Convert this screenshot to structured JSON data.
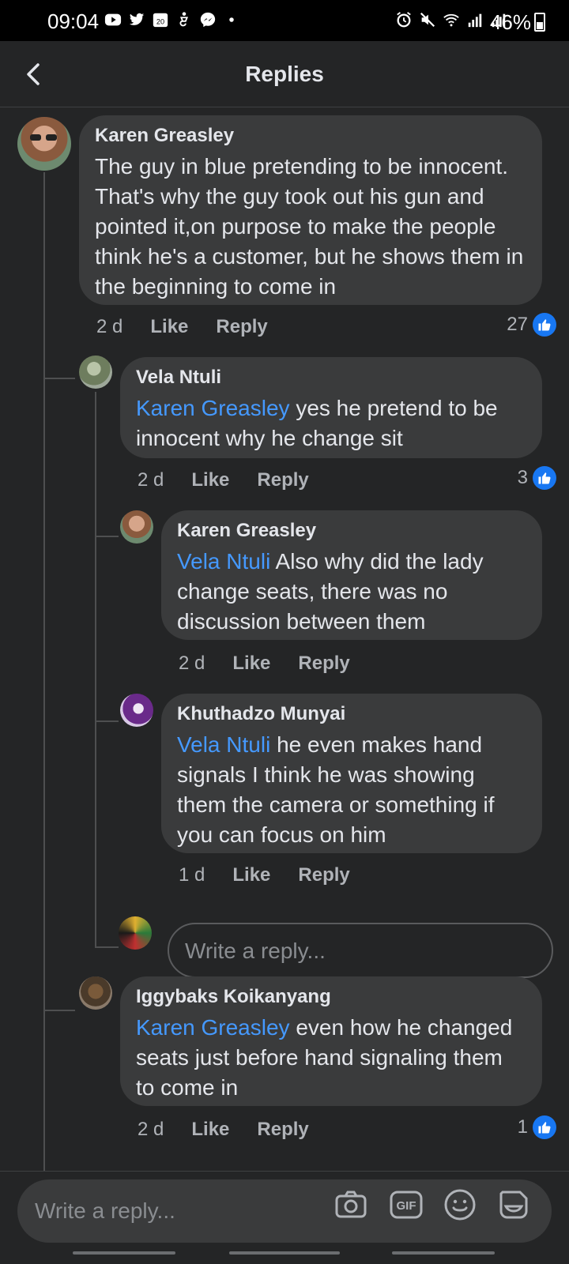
{
  "status_bar": {
    "time": "09:04",
    "left_icons": [
      "youtube-icon",
      "twitter-icon",
      "calendar-icon",
      "accessibility-icon",
      "messenger-icon",
      "dot-icon"
    ],
    "calendar_day": "20",
    "right_icons": [
      "alarm-icon",
      "mute-icon",
      "wifi-icon",
      "signal-icon",
      "signal-icon"
    ],
    "battery": "46%"
  },
  "header": {
    "title": "Replies"
  },
  "comments": [
    {
      "author": "Karen Greasley",
      "mention": "",
      "text": "The guy in blue pretending to be innocent. That's why the guy took out his gun and pointed it,on purpose to make the people think he's a customer, but he shows them in the beginning to come in",
      "time": "2 d",
      "like": "Like",
      "reply": "Reply",
      "likes": "27"
    },
    {
      "author": "Vela Ntuli",
      "mention": "Karen Greasley",
      "text": " yes he pretend to be innocent why he change sit",
      "time": "2 d",
      "like": "Like",
      "reply": "Reply",
      "likes": "3"
    },
    {
      "author": "Karen Greasley",
      "mention": "Vela Ntuli",
      "text": " Also why did the lady change seats, there was no discussion between them",
      "time": "2 d",
      "like": "Like",
      "reply": "Reply",
      "likes": ""
    },
    {
      "author": "Khuthadzo Munyai",
      "mention": "Vela Ntuli",
      "text": " he even makes hand signals I think he was showing them the camera or something if you can focus on him",
      "time": "1 d",
      "like": "Like",
      "reply": "Reply",
      "likes": ""
    },
    {
      "author": "Iggybaks Koikanyang",
      "mention": "Karen Greasley",
      "text": " even how he changed seats just before hand signaling them to come in",
      "time": "2 d",
      "like": "Like",
      "reply": "Reply",
      "likes": "1"
    }
  ],
  "inline_reply": {
    "placeholder": "Write a reply..."
  },
  "composer": {
    "placeholder": "Write a reply...",
    "gif_label": "GIF",
    "icons": [
      "camera-icon",
      "gif-icon",
      "emoji-icon",
      "sticker-icon"
    ]
  },
  "colors": {
    "background": "#242526",
    "bubble": "#3a3b3c",
    "mention": "#4599ff",
    "like_badge": "#1877f2"
  }
}
